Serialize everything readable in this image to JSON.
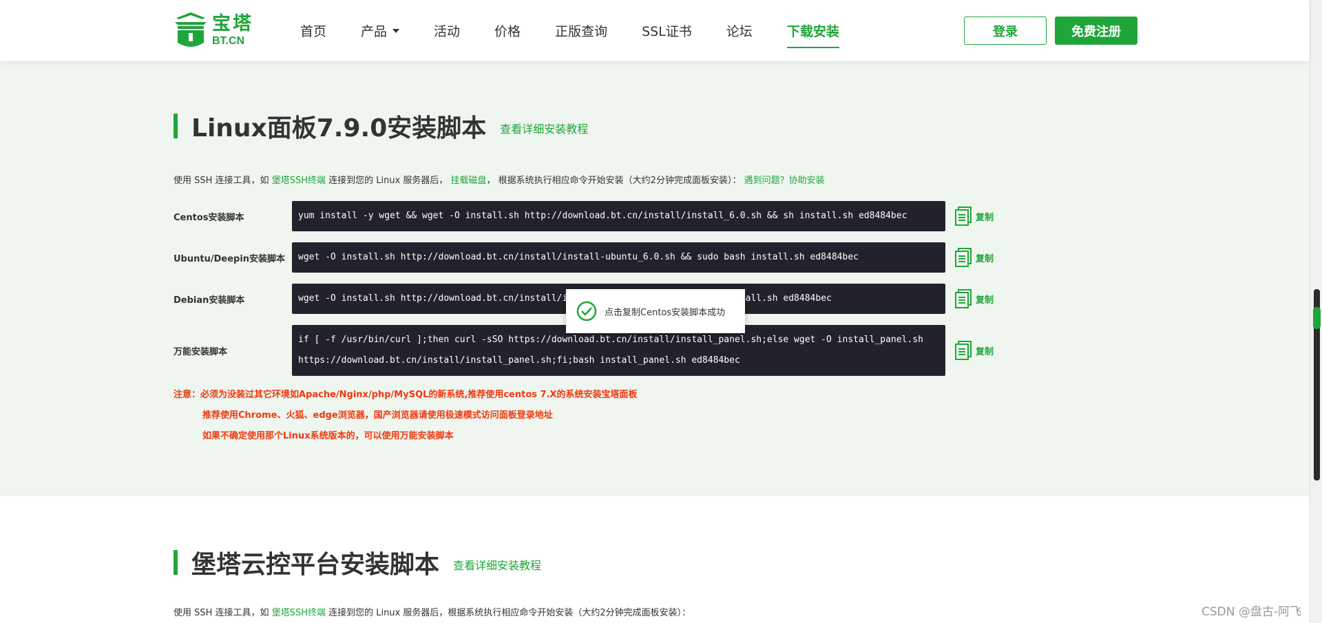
{
  "header": {
    "logo_cn": "宝塔",
    "logo_en": "BT.CN",
    "nav": [
      {
        "label": "首页"
      },
      {
        "label": "产品"
      },
      {
        "label": "活动"
      },
      {
        "label": "价格"
      },
      {
        "label": "正版查询"
      },
      {
        "label": "SSL证书"
      },
      {
        "label": "论坛"
      },
      {
        "label": "下载安装"
      }
    ],
    "login_label": "登录",
    "register_label": "免费注册"
  },
  "section1": {
    "title": "Linux面板7.9.0安装脚本",
    "tutorial_link": "查看详细安装教程",
    "intro": {
      "p1": "使用 SSH 连接工具，如 ",
      "link1": "堡塔SSH终端",
      "p2": " 连接到您的 Linux 服务器后， ",
      "link2": "挂载磁盘",
      "p3": "， 根据系统执行相应命令开始安装（大约2分钟完成面板安装）： ",
      "link3": "遇到问题？协助安装"
    },
    "scripts": [
      {
        "label": "Centos安装脚本",
        "line1": "yum install -y wget && wget -O install.sh http://download.bt.cn/install/install_6.0.sh && sh install.sh ed8484bec",
        "line2": ""
      },
      {
        "label": "Ubuntu/Deepin安装脚本",
        "line1": "wget -O install.sh http://download.bt.cn/install/install-ubuntu_6.0.sh && sudo bash install.sh ed8484bec",
        "line2": ""
      },
      {
        "label": "Debian安装脚本",
        "line1": "wget -O install.sh http://download.bt.cn/install/install-ubuntu_6.0.sh && bash install.sh ed8484bec",
        "line2": ""
      },
      {
        "label": "万能安装脚本",
        "line1": "if [ -f /usr/bin/curl ];then curl -sSO https://download.bt.cn/install/install_panel.sh;else wget -O install_panel.sh",
        "line2": "https://download.bt.cn/install/install_panel.sh;fi;bash install_panel.sh ed8484bec"
      }
    ],
    "copy_label": "复制",
    "notes": [
      "注意：必须为没装过其它环境如Apache/Nginx/php/MySQL的新系统,推荐使用centos 7.X的系统安装宝塔面板",
      "推荐使用Chrome、火狐、edge浏览器，国产浏览器请使用极速模式访问面板登录地址",
      "如果不确定使用那个Linux系统版本的，可以使用万能安装脚本"
    ]
  },
  "toast": {
    "text": "点击复制Centos安装脚本成功"
  },
  "section2": {
    "title": "堡塔云控平台安装脚本",
    "tutorial_link": "查看详细安装教程",
    "intro": {
      "p1": "使用 SSH 连接工具，如 ",
      "link1": "堡塔SSH终端",
      "p2": " 连接到您的 Linux 服务器后，根据系统执行相应命令开始安装（大约2分钟完成面板安装）："
    }
  },
  "watermark": "CSDN @盘古-阿飞",
  "colors": {
    "brand": "#20a53a",
    "warning": "#f0380f",
    "code_bg": "#22222c",
    "section_bg": "#eef6ef"
  }
}
